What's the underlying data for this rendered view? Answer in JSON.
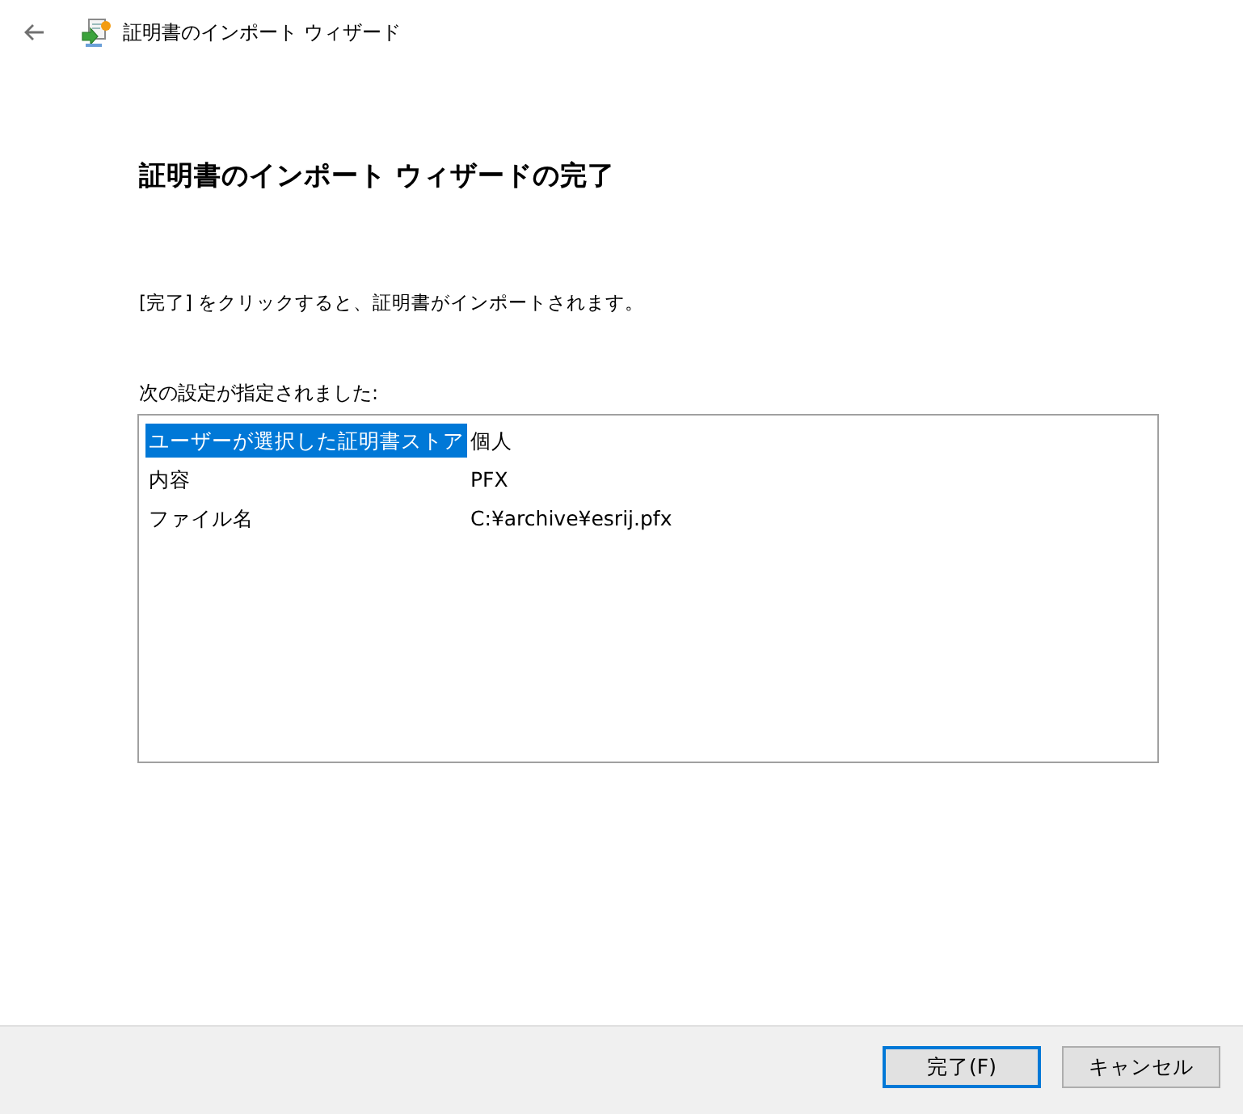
{
  "window": {
    "title": "証明書のインポート ウィザード"
  },
  "heading": "証明書のインポート ウィザードの完了",
  "instruction": "[完了] をクリックすると、証明書がインポートされます。",
  "settings": {
    "label": "次の設定が指定されました:",
    "rows": [
      {
        "name": "ユーザーが選択した証明書ストア",
        "value": "個人",
        "selected": true
      },
      {
        "name": "内容",
        "value": "PFX",
        "selected": false
      },
      {
        "name": "ファイル名",
        "value": "C:¥archive¥esrij.pfx",
        "selected": false
      }
    ]
  },
  "buttons": [
    {
      "label": "完了(F)",
      "default": true
    },
    {
      "label": "キャンセル",
      "default": false
    }
  ]
}
